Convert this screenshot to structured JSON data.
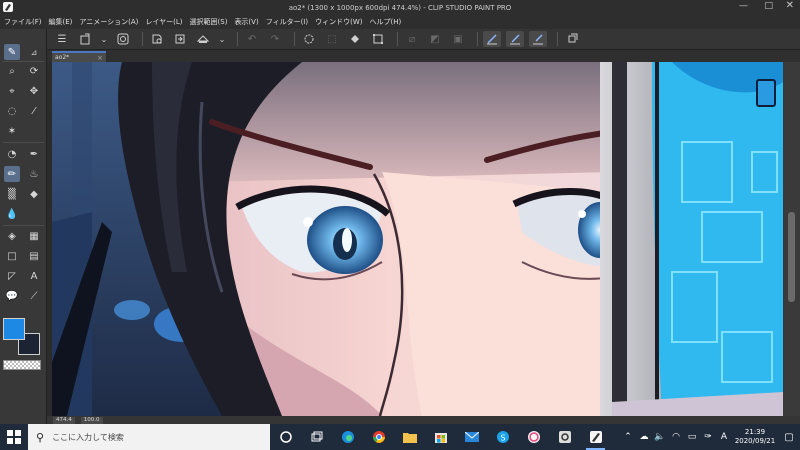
{
  "window": {
    "title": "ao2* (1300 x 1000px 600dpi 474.4%) - CLIP STUDIO PAINT PRO"
  },
  "menu": [
    "ファイル(F)",
    "編集(E)",
    "アニメーション(A)",
    "レイヤー(L)",
    "選択範囲(S)",
    "表示(V)",
    "フィルター(I)",
    "ウィンドウ(W)",
    "ヘルプ(H)"
  ],
  "document_tab": {
    "name": "ao2*",
    "close": "×"
  },
  "status": {
    "zoom": "474.4",
    "angle": "100.0"
  },
  "colors": {
    "main": "#1e88e5",
    "sub": "#1c2433",
    "taskbar": "#1f2a3a",
    "accent": "#4a78c2"
  },
  "taskbar": {
    "search_placeholder": "ここに入力して検索",
    "apps": [
      "task-view-icon",
      "widgets-icon",
      "edge-icon",
      "chrome-icon",
      "file-explorer-icon",
      "store-icon",
      "mail-icon",
      "skype-icon",
      "itunes-icon",
      "clip-studio-icon",
      "clip-studio-paint-icon"
    ]
  },
  "tray": {
    "ime": "A",
    "time": "21:39",
    "date": "2020/09/21"
  }
}
